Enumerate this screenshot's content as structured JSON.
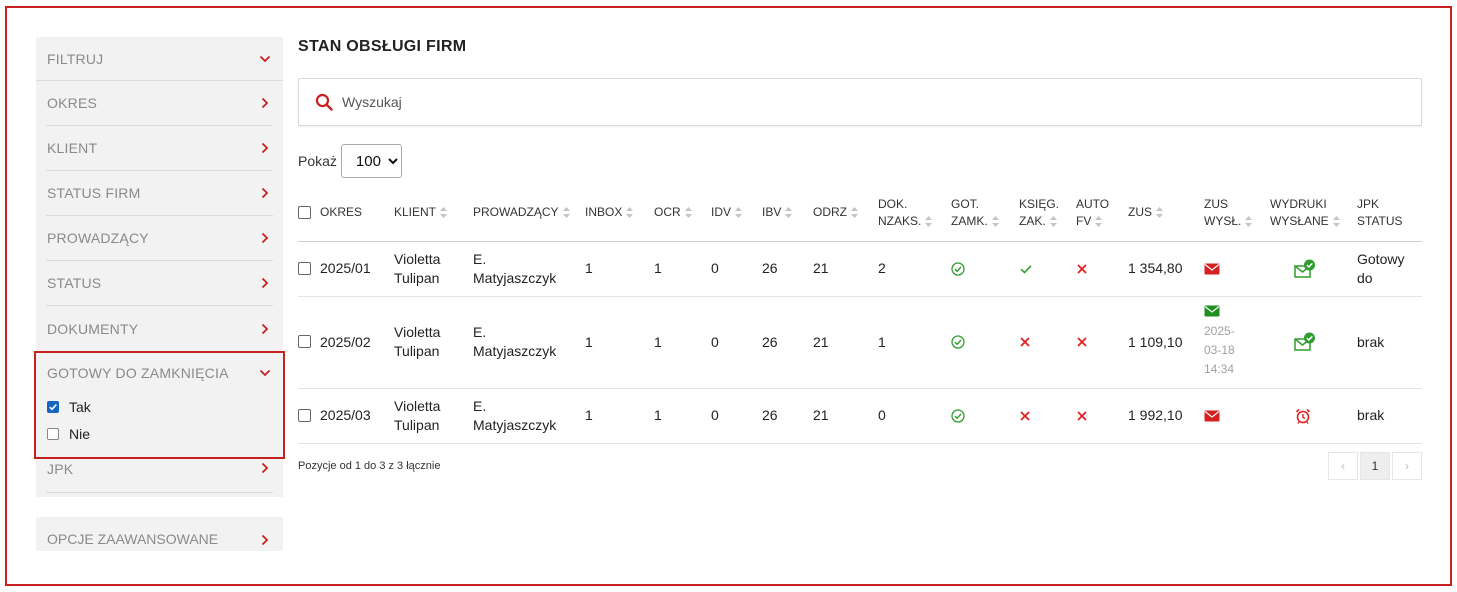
{
  "sidebar": {
    "filter_label": "FILTRUJ",
    "items_top": [
      "OKRES",
      "KLIENT",
      "STATUS FIRM",
      "PROWADZĄCY",
      "STATUS",
      "DOKUMENTY"
    ],
    "gotowy": {
      "label": "GOTOWY DO ZAMKNIĘCIA",
      "options": [
        {
          "label": "Tak",
          "checked": true
        },
        {
          "label": "Nie",
          "checked": false
        }
      ]
    },
    "jpk_label": "JPK",
    "advanced_label": "OPCJE ZAAWANSOWANE"
  },
  "main": {
    "title": "STAN OBSŁUGI FIRM",
    "search_placeholder": "Wyszukaj",
    "show_label": "Pokaż",
    "page_size": "100",
    "columns": {
      "okres": "OKRES",
      "klient": "KLIENT",
      "prowadzacy": "PROWADZĄCY",
      "inbox": "INBOX",
      "ocr": "OCR",
      "idv": "IDV",
      "ibv": "IBV",
      "odrz": "ODRZ",
      "dok_1": "DOK.",
      "dok_2": "NZAKS.",
      "got_1": "GOT.",
      "got_2": "ZAMK.",
      "ksieg_1": "KSIĘG.",
      "ksieg_2": "ZAK.",
      "auto_1": "AUTO",
      "auto_2": "FV",
      "zus": "ZUS",
      "zusw_1": "ZUS",
      "zusw_2": "WYSŁ.",
      "wydr_1": "WYDRUKI",
      "wydr_2": "WYSŁANE",
      "jpk_1": "JPK",
      "jpk_2": "STATUS"
    },
    "rows": [
      {
        "okres": "2025/01",
        "klient_1": "Violetta",
        "klient_2": "Tulipan",
        "prow_1": "E.",
        "prow_2": "Matyjaszczyk",
        "inbox": "1",
        "ocr": "1",
        "idv": "0",
        "ibv": "26",
        "odrz": "21",
        "dok": "2",
        "got": "ok",
        "ksieg": "check",
        "auto": "x",
        "zus": "1 354,80",
        "zus_wysl": "mail-red",
        "zus_date": "",
        "wydruki": "mail-ok",
        "jpk_1": "Gotowy",
        "jpk_2": "do"
      },
      {
        "okres": "2025/02",
        "klient_1": "Violetta",
        "klient_2": "Tulipan",
        "prow_1": "E.",
        "prow_2": "Matyjaszczyk",
        "inbox": "1",
        "ocr": "1",
        "idv": "0",
        "ibv": "26",
        "odrz": "21",
        "dok": "1",
        "got": "ok",
        "ksieg": "x",
        "auto": "x",
        "zus": "1 109,10",
        "zus_wysl": "mail-green",
        "zus_date_1": "2025-",
        "zus_date_2": "03-18",
        "zus_date_3": "14:34",
        "wydruki": "mail-ok",
        "jpk_1": "brak",
        "jpk_2": ""
      },
      {
        "okres": "2025/03",
        "klient_1": "Violetta",
        "klient_2": "Tulipan",
        "prow_1": "E.",
        "prow_2": "Matyjaszczyk",
        "inbox": "1",
        "ocr": "1",
        "idv": "0",
        "ibv": "26",
        "odrz": "21",
        "dok": "0",
        "got": "ok",
        "ksieg": "x",
        "auto": "x",
        "zus": "1 992,10",
        "zus_wysl": "mail-red",
        "zus_date": "",
        "wydruki": "alarm-clock",
        "jpk_1": "brak",
        "jpk_2": ""
      }
    ],
    "footer_text": "Pozycje od 1 do 3 z 3 łącznie",
    "pagination": {
      "prev": "‹",
      "current": "1",
      "next": "›"
    }
  },
  "colors": {
    "accent_red": "#c8201f",
    "ok_green": "#2e9e2e",
    "x_red": "#e02020",
    "checkbox_blue": "#1565c0"
  }
}
